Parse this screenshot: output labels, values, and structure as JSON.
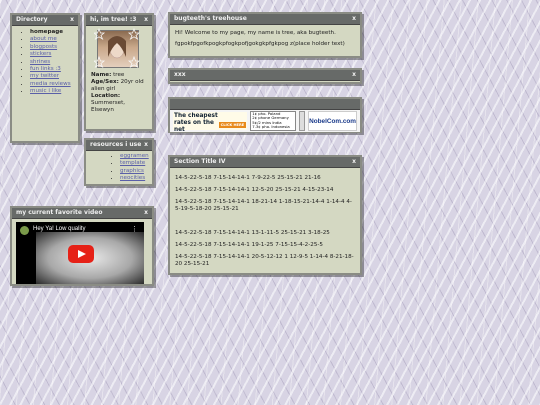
{
  "directory": {
    "title": "Directory",
    "close": "x",
    "items": [
      {
        "label": "homepage"
      },
      {
        "label": "about me"
      },
      {
        "label": "blogposts"
      },
      {
        "label": "stickers"
      },
      {
        "label": "shrines"
      },
      {
        "label": "fun links :3"
      },
      {
        "label": "my twitter"
      },
      {
        "label": "media reviews"
      },
      {
        "label": "music i like"
      }
    ]
  },
  "profile": {
    "title": "hi, im tree! :3",
    "close": "x",
    "name_label": "Name:",
    "name_value": "tree",
    "age_label": "Age/Sex:",
    "age_value": "20yr old alien girl",
    "location_label": "Location:",
    "location_value": "Summerset, Elsewyn"
  },
  "resources": {
    "title": "resources i use",
    "close": "x",
    "items": [
      {
        "label": "eggramen"
      },
      {
        "label": "template"
      },
      {
        "label": "graphics"
      },
      {
        "label": "neocities"
      }
    ]
  },
  "video": {
    "title": "my current favorite video",
    "close": "x",
    "video_title": "Hey Ya! Low quality",
    "menu_glyph": "⋮"
  },
  "treehouse": {
    "title": "bugteeth's treehouse",
    "close": "x",
    "line1": "Hi! Welcome to my page, my name is tree, aka bugteeth.",
    "line2": "fgpokfpgofkpogkpfogkpofjgokgkpfgkpog z(place holder text)"
  },
  "xxx": {
    "title": "xxx",
    "close": "x"
  },
  "ad": {
    "title": "",
    "headline": "The cheapest rates on the net",
    "cta": "CLICK HERE",
    "rates": [
      "1¢ pho. Poland",
      "2¢ phone Germany",
      "5¢/2 mins India",
      "7.3¢ pho. Indonesia"
    ],
    "brand": "NobelCom.com",
    "accent": "#e88a1a",
    "brand_color": "#1a3a8a"
  },
  "section4": {
    "title": "Section Title IV",
    "close": "x",
    "lines": [
      "14-5-22-5-18 7-15-14-14-1 7-9-22-5 25-15-21 21-16",
      "14-5-22-5-18 7-15-14-14-1 12-5-20 25-15-21 4-15-23-14",
      "14-5-22-5-18 7-15-14-14-1 18-21-14 1-18-15-21-14-4 1-14-4 4-5-19-5-18-20 25-15-21",
      "",
      "14-5-22-5-18 7-15-14-14-1 13-1-11-5 25-15-21 3-18-25",
      "14-5-22-5-18 7-15-14-14-1 19-1-25 7-15-15-4-2-25-5",
      "14-5-22-5-18 7-15-14-14-1 20-5-12-12 1 12-9-5 1-14-4 8-21-18-20 25-15-21"
    ]
  }
}
